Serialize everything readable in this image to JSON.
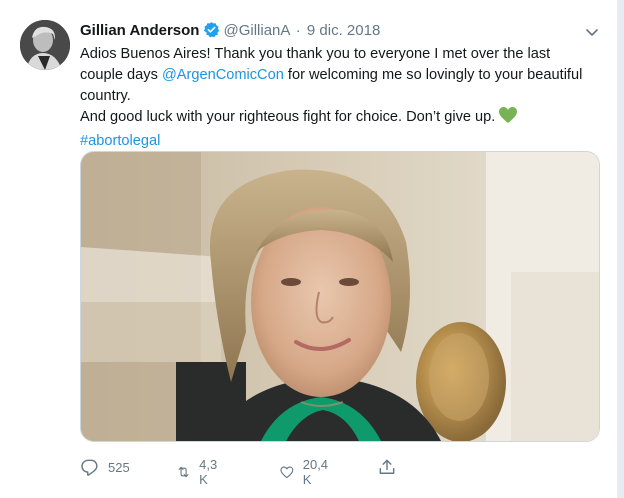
{
  "tweet": {
    "author_name": "Gillian Anderson",
    "handle": "@GillianA",
    "separator": "·",
    "date": "9 dic. 2018",
    "text_line1": "Adios Buenos Aires! Thank you thank you to everyone I met over the last",
    "text_line2_before": "couple days ",
    "mention": "@ArgenComicCon",
    "text_line2_after": " for welcoming me so lovingly to your beautiful",
    "text_line3": "country.",
    "text_line4": "And good luck with your righteous fight for choice. Don’t give up. ",
    "hashtag": "#abortolegal"
  },
  "actions": {
    "reply_count": "525",
    "retweet_count": "4,3 K",
    "like_count": "20,4 K"
  },
  "colors": {
    "link": "#1b95e0",
    "verified": "#1da1f2",
    "heart_emoji": "#77b255",
    "secondary_text": "#657786"
  },
  "icons": [
    "verified-badge-icon",
    "caret-down-icon",
    "green-heart-emoji",
    "reply-icon",
    "retweet-icon",
    "like-icon",
    "share-icon"
  ]
}
